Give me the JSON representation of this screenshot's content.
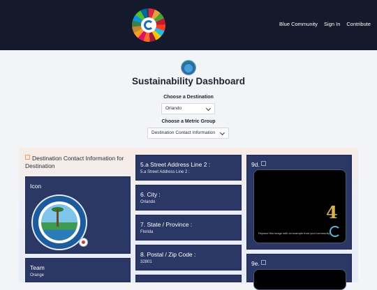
{
  "header": {
    "nav": [
      "Blue Community",
      "Sign In",
      "Contribute"
    ]
  },
  "page_title": "Sustainability Dashboard",
  "destination": {
    "label": "Choose a Destination",
    "selected": "Orlando"
  },
  "metric_group": {
    "label": "Choose a Metric Group",
    "selected": "Destination Contact Information"
  },
  "section": {
    "title": "Destination Contact Information for Destination"
  },
  "cards": {
    "icon": {
      "title": "Icon"
    },
    "seal_text": {
      "top": "CITY OF ORLANDO FLORIDA",
      "bottom": "THE CITY BEAUTIFUL"
    },
    "team": {
      "title": "Team",
      "value": "Orange"
    },
    "street2": {
      "title": "5.a Street Address Line 2 :",
      "value": "5.a Street Address Line 2 :"
    },
    "city": {
      "title": "6. City :",
      "value": "Orlando"
    },
    "state": {
      "title": "7. State / Province :",
      "value": "Florida"
    },
    "postal": {
      "title": "8. Postal / Zip Code :",
      "value": "32801"
    },
    "sdg_9d": {
      "title": "9d.",
      "number": "4",
      "caption": "Replace this image with an example from your community"
    },
    "sdg_9e": {
      "title": "9e."
    }
  }
}
